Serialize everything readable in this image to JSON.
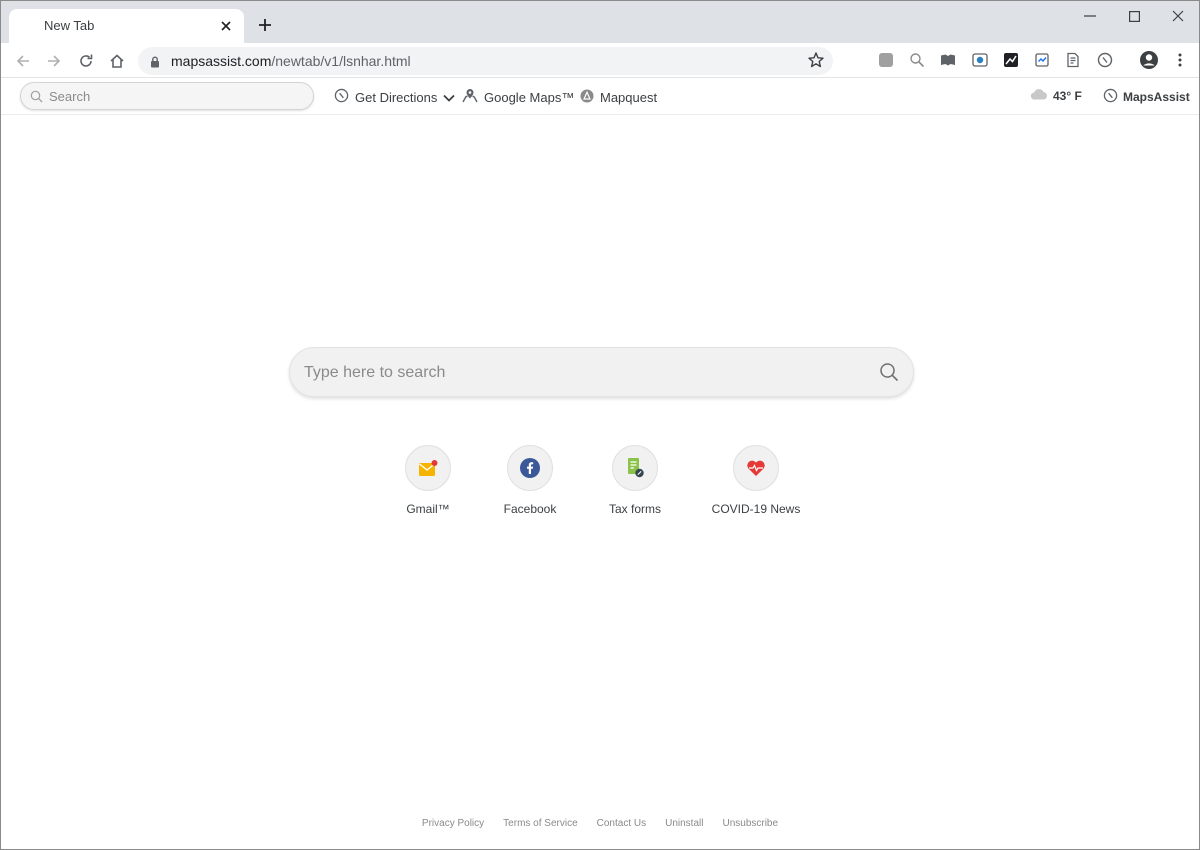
{
  "browser": {
    "tab_title": "New Tab",
    "url_host": "mapsassist.com",
    "url_path": "/newtab/v1/lsnhar.html"
  },
  "header": {
    "search_placeholder": "Search",
    "links": {
      "directions": "Get Directions",
      "google_maps": "Google Maps™",
      "mapquest": "Mapquest"
    },
    "weather": "43° F",
    "brand": "MapsAssist"
  },
  "main": {
    "search_placeholder": "Type here to search",
    "shortcuts": [
      {
        "label": "Gmail™",
        "icon": "gmail-icon"
      },
      {
        "label": "Facebook",
        "icon": "facebook-icon"
      },
      {
        "label": "Tax forms",
        "icon": "tax-forms-icon"
      },
      {
        "label": "COVID-19 News",
        "icon": "covid-news-icon"
      }
    ]
  },
  "footer": {
    "links": [
      "Privacy Policy",
      "Terms of Service",
      "Contact Us",
      "Uninstall",
      "Unsubscribe"
    ]
  },
  "colors": {
    "tab_strip": "#dee1e6",
    "facebook": "#3b5998",
    "gmail": "#f5b400",
    "tax": "#8bc34a",
    "covid": "#e53935"
  }
}
